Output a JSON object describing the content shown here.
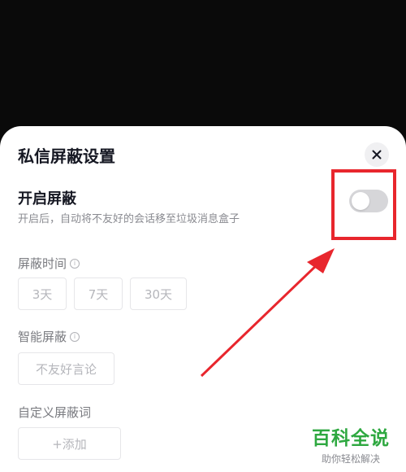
{
  "sheet": {
    "title": "私信屏蔽设置",
    "close_icon": "close-icon"
  },
  "shield": {
    "label": "开启屏蔽",
    "description": "开启后，自动将不友好的会话移至垃圾消息盒子",
    "toggle_on": false
  },
  "duration": {
    "label": "屏蔽时间",
    "info_icon": "info-icon",
    "options": [
      "3天",
      "7天",
      "30天"
    ]
  },
  "smart": {
    "label": "智能屏蔽",
    "info_icon": "info-icon",
    "options": [
      "不友好言论"
    ]
  },
  "custom": {
    "label": "自定义屏蔽词",
    "add_label": "+添加"
  },
  "watermark": {
    "logo": "百科全说",
    "tagline": "助你轻松解决"
  },
  "annotation": {
    "highlight_color": "#e8262d"
  }
}
